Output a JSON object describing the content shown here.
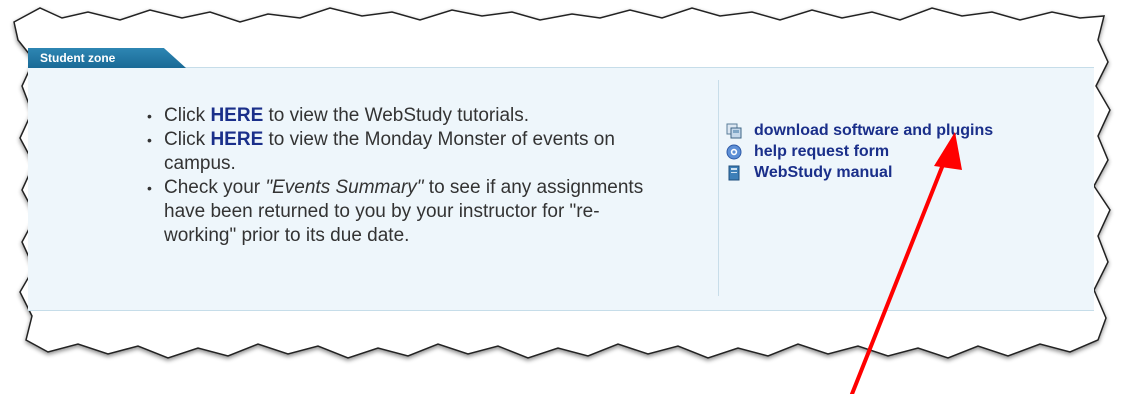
{
  "student_zone": {
    "tab_label": "Student zone",
    "tips": {
      "tip1": {
        "pre": "Click ",
        "link": "HERE",
        "post": " to view the WebStudy tutorials."
      },
      "tip2": {
        "pre": " Click ",
        "link": "HERE",
        "post": " to view the Monday Monster of events on campus."
      },
      "tip3": {
        "pre": "Check your ",
        "emph": "\"Events Summary\"",
        "post": " to see if any assignments have been returned to you by your instructor for \"re-working\" prior to its due date."
      }
    },
    "links": {
      "download": {
        "label": "download software and plugins",
        "icon": "download-software-icon"
      },
      "help": {
        "label": "help request form",
        "icon": "help-request-icon"
      },
      "manual": {
        "label": "WebStudy manual",
        "icon": "manual-book-icon"
      }
    }
  },
  "annotation": {
    "arrow_color": "#ff0000"
  },
  "colors": {
    "tab": "#1f76a3",
    "panel": "#eef6fb",
    "link": "#1a2f8a"
  }
}
